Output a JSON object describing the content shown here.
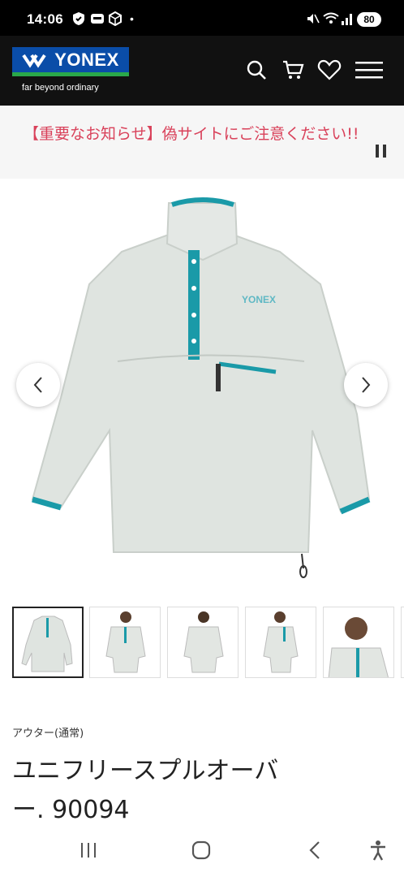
{
  "status_bar": {
    "time": "14:06",
    "battery": "80",
    "dot": "•"
  },
  "header": {
    "logo_text": "YONEX",
    "tagline": "far beyond ordinary"
  },
  "notice": {
    "text": "【重要なお知らせ】偽サイトにご注意ください!!"
  },
  "product": {
    "category": "アウター(通常)",
    "title_line1": "ユニフリースプルオーバ",
    "title_line2": "ー. 90094",
    "image_brand": "YONEX"
  },
  "colors": {
    "header_bg": "#111111",
    "notice_red": "#d9415a",
    "teal": "#1a9aa8",
    "fleece": "#dfe4e0"
  },
  "icons": [
    "search-icon",
    "cart-icon",
    "heart-icon",
    "menu-icon",
    "pause-icon",
    "chevron-left-icon",
    "chevron-right-icon"
  ]
}
